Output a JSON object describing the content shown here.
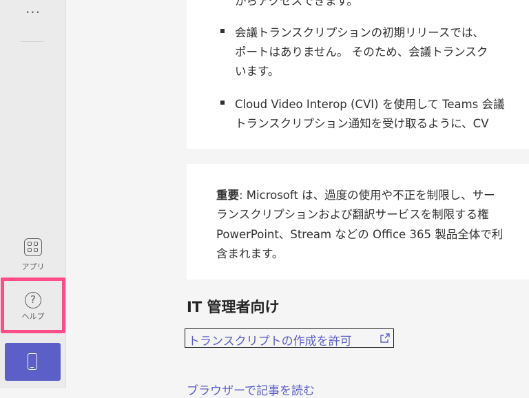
{
  "rail": {
    "apps_label": "アプリ",
    "help_label": "ヘルプ",
    "help_glyph": "?",
    "more_glyph": "···"
  },
  "colors": {
    "accent": "#5b5fc7",
    "highlight": "#ff4d8a"
  },
  "content": {
    "card1": {
      "top_line": "からアクセスできます。",
      "bullet1_line1": "会議トランスクリプションの初期リリースでは、",
      "bullet1_line2": "ポートはありません。 そのため、会議トランスク",
      "bullet1_line3": "います。",
      "bullet2_line1": "Cloud Video Interop (CVI) を使用して Teams 会議",
      "bullet2_line2": "トランスクリプション通知を受け取るように、CV"
    },
    "card2": {
      "important_label": "重要",
      "line1_rest": ": Microsoft は、過度の使用や不正を制限し、サー",
      "line2": "ランスクリプションおよび翻訳サービスを制限する権",
      "line3": "PowerPoint、Stream などの Office 365 製品全体で利",
      "line4": "含まれます。"
    },
    "it_heading": "IT 管理者向け",
    "link_allow_transcript": "トランスクリプトの作成を許可",
    "link_read_browser": "ブラウザーで記事を読む"
  }
}
